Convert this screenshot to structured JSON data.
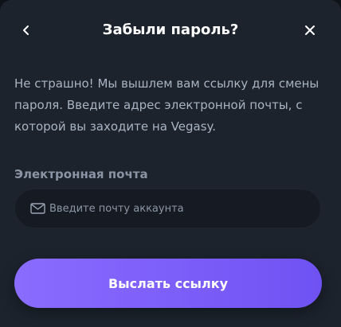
{
  "header": {
    "title": "Забыли пароль?",
    "back_icon": "chevron-left-icon",
    "close_icon": "close-icon"
  },
  "description": "Не страшно! Мы вышлем вам ссылку для смены пароля. Введите адрес электронной почты, с которой вы заходите на Vegasy.",
  "email_field": {
    "label": "Электронная почта",
    "value": "",
    "placeholder": "Введите почту аккаунта",
    "icon": "mail-icon"
  },
  "submit_button": {
    "label": "Выслать ссылку"
  },
  "colors": {
    "background": "#1c232d",
    "accent_gradient_start": "#8a6cff",
    "accent_gradient_end": "#6f52f3",
    "text_primary": "#ffffff",
    "text_secondary": "#a9b4c2"
  }
}
